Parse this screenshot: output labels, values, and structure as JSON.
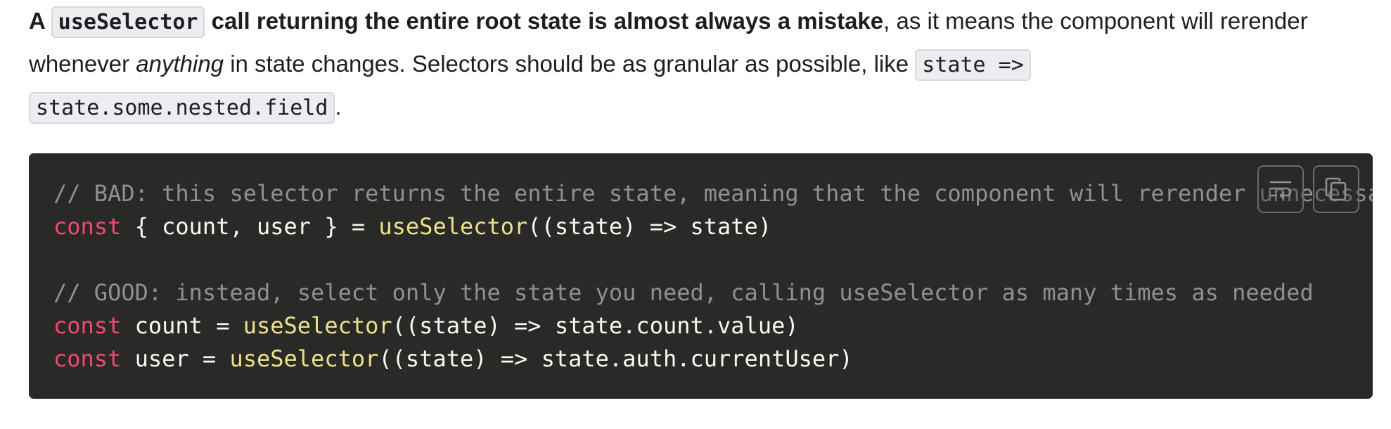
{
  "paragraph": {
    "lead_a": "A ",
    "code_useSelector": "useSelector",
    "bold_tail": " call returning the entire root state is almost always a mistake",
    "rest_1": ", as it means the component will rerender",
    "line2_a": "whenever ",
    "anything": "anything",
    "line2_b": " in state changes. Selectors should be as granular as possible, like ",
    "code_state_arrow": "state =>",
    "code_state_field": "state.some.nested.field",
    "period": "."
  },
  "code_block": {
    "line1_comment": "// BAD: this selector returns the entire state, meaning that the component will rerender unnecessarily",
    "line2_kw": "const",
    "line2_a": " { count, user } = ",
    "line2_fn": "useSelector",
    "line2_b": "((state) => state)",
    "line4_comment": "// GOOD: instead, select only the state you need, calling useSelector as many times as needed",
    "line5_kw": "const",
    "line5_a": " count = ",
    "line5_fn": "useSelector",
    "line5_b": "((state) => state.count.value)",
    "line6_kw": "const",
    "line6_a": " user = ",
    "line6_fn": "useSelector",
    "line6_b": "((state) => state.auth.currentUser)",
    "buttons": {
      "wrap_icon": "word-wrap-icon",
      "copy_icon": "copy-icon"
    }
  }
}
